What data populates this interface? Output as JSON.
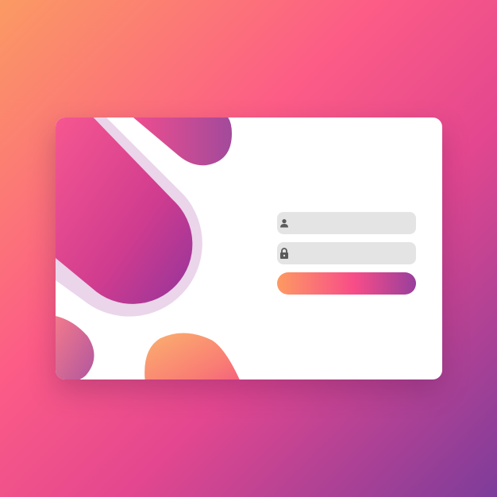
{
  "form": {
    "username_placeholder": "",
    "password_placeholder": "",
    "submit_label": ""
  },
  "icons": {
    "username": "user-icon",
    "password": "lock-icon"
  },
  "colors": {
    "background_start": "#fb9a63",
    "background_mid": "#fc5c86",
    "background_end": "#7d3c9a",
    "button_start": "#fd9a62",
    "button_end": "#983f9c",
    "field_background": "#e4e4e4",
    "card": "#ffffff"
  }
}
